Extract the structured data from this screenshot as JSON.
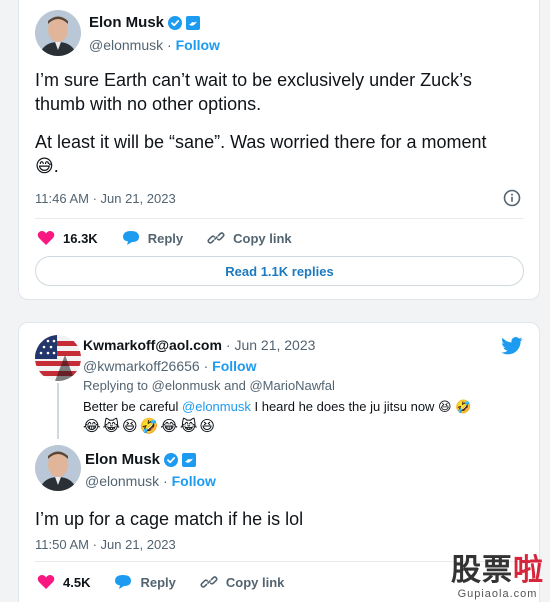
{
  "colors": {
    "accent": "#1d9bf0",
    "like": "#f91880",
    "verified": "#1d9bf0"
  },
  "tweet1": {
    "author": {
      "name": "Elon Musk",
      "handle": "@elonmusk",
      "follow_label": "Follow",
      "avatar_icon": "avatar-portrait"
    },
    "text_line1": "I’m sure Earth can’t wait to be exclusively under Zuck’s",
    "text_line2": "thumb with no other options.",
    "text_line3": "At least it will be “sane”. Was worried there for a moment",
    "text_emoji": "😅",
    "text_period": ".",
    "timestamp": "11:46 AM · Jun 21, 2023",
    "likes": "16.3K",
    "reply_label": "Reply",
    "copy_label": "Copy link",
    "read_replies": "Read 1.1K replies"
  },
  "tweet2": {
    "author": {
      "name": "Kwmarkoff@aol.com",
      "date": "· Jun 21, 2023",
      "handle": "@kwmarkoff26656",
      "follow_label": "Follow",
      "avatar_icon": "flag-avatar"
    },
    "replying_prefix": "Replying to",
    "replying_to_1": "@elonmusk",
    "replying_and": "and",
    "replying_to_2": "@MarioNawfal",
    "body_prefix": "Better be careful",
    "body_mention": "@elonmusk",
    "body_suffix": "I heard he does the ju jitsu now 😆 🤣",
    "emoji_line": "😂😹😆🤣😂😹😆"
  },
  "tweet3": {
    "author": {
      "name": "Elon Musk",
      "handle": "@elonmusk",
      "follow_label": "Follow"
    },
    "text": "I’m up for a cage match if he is lol",
    "timestamp": "11:50 AM · Jun 21, 2023",
    "likes": "4.5K",
    "reply_label": "Reply",
    "copy_label": "Copy link"
  },
  "watermark": {
    "text_a": "股票",
    "text_b": "啦",
    "site": "Gupiaola.com"
  }
}
